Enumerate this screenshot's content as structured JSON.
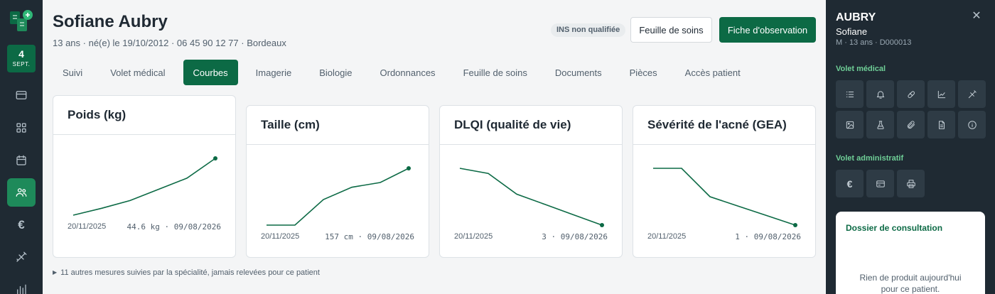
{
  "nav": {
    "date_day": "4",
    "date_month": "SEPT.",
    "items": [
      {
        "icon": "credit-card-icon"
      },
      {
        "icon": "grid-icon"
      },
      {
        "icon": "calendar-icon"
      },
      {
        "icon": "users-icon",
        "active": true
      },
      {
        "icon": "euro-icon",
        "glyph": "€"
      },
      {
        "icon": "syringe-icon"
      },
      {
        "icon": "bar-chart-icon"
      }
    ]
  },
  "patient": {
    "name": "Sofiane Aubry",
    "meta": "13 ans · né(e) le 19/10/2012 · 06 45 90 12 77 · Bordeaux",
    "ins_status": "INS non qualifiée"
  },
  "actions": {
    "sheet_label": "Feuille de soins",
    "observation_label": "Fiche d'observation"
  },
  "tabs": [
    {
      "label": "Suivi"
    },
    {
      "label": "Volet médical"
    },
    {
      "label": "Courbes",
      "active": true
    },
    {
      "label": "Imagerie"
    },
    {
      "label": "Biologie"
    },
    {
      "label": "Ordonnances"
    },
    {
      "label": "Feuille de soins"
    },
    {
      "label": "Documents"
    },
    {
      "label": "Pièces"
    },
    {
      "label": "Accès patient"
    }
  ],
  "curves": [
    {
      "title": "Poids (kg)",
      "start_date": "20/11/2025",
      "last_label": "44.6 kg · 09/08/2026",
      "values": [
        38.0,
        38.8,
        39.7,
        41.0,
        42.3,
        44.6
      ]
    },
    {
      "title": "Taille (cm)",
      "start_date": "20/11/2025",
      "last_label": "157 cm · 09/08/2026",
      "values": [
        151,
        151,
        153.7,
        155,
        155.5,
        157
      ]
    },
    {
      "title": "DLQI (qualité de vie)",
      "start_date": "20/11/2025",
      "last_label": "3 · 09/08/2026",
      "values": [
        14,
        13,
        9,
        7,
        5,
        3
      ]
    },
    {
      "title": "Sévérité de l'acné (GEA)",
      "start_date": "20/11/2025",
      "last_label": "1 · 09/08/2026",
      "values": [
        4,
        4,
        2.5,
        2,
        1.5,
        1
      ]
    }
  ],
  "more_measures": "11 autres mesures suivies par la spécialité, jamais relevées pour ce patient",
  "panel": {
    "last_name": "AUBRY",
    "first_name": "Sofiane",
    "meta": "M · 13 ans · D000013",
    "medical_title": "Volet médical",
    "medical_tools": [
      {
        "icon": "list-icon"
      },
      {
        "icon": "bell-icon"
      },
      {
        "icon": "pill-icon"
      },
      {
        "icon": "chart-line-icon"
      },
      {
        "icon": "syringe-icon"
      },
      {
        "icon": "image-icon"
      },
      {
        "icon": "flask-icon"
      },
      {
        "icon": "paperclip-icon"
      },
      {
        "icon": "document-icon"
      },
      {
        "icon": "info-icon"
      }
    ],
    "admin_title": "Volet administratif",
    "admin_tools": [
      {
        "icon": "euro-icon",
        "glyph": "€"
      },
      {
        "icon": "credit-card-icon"
      },
      {
        "icon": "printer-icon"
      }
    ],
    "dossier_title": "Dossier de consultation",
    "dossier_empty": "Rien de produit aujourd'hui pour ce patient."
  },
  "colors": {
    "brand": "#0c6a45",
    "rail": "#1f2a33",
    "accent": "#6fcf97"
  }
}
